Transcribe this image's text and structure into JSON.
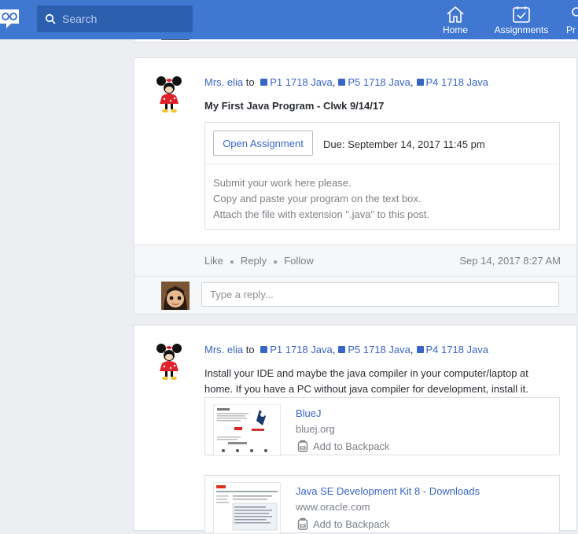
{
  "search": {
    "placeholder": "Search"
  },
  "nav": {
    "home": "Home",
    "assignments": "Assignments",
    "profile_partial": "Pr"
  },
  "post1": {
    "author": "Mrs. elia",
    "to": "to",
    "groups": [
      "P1 1718 Java",
      "P5 1718 Java",
      "P4 1718 Java"
    ],
    "title": "My First Java Program - Clwk 9/14/17",
    "open_label": "Open Assignment",
    "due": "Due: September 14, 2017 11:45 pm",
    "description": [
      "Submit your work here please.",
      "Copy and paste your program on the text box.",
      "Attach the file with extension \".java\" to this post."
    ],
    "actions": {
      "like": "Like",
      "reply": "Reply",
      "follow": "Follow"
    },
    "timestamp": "Sep 14, 2017 8:27 AM",
    "reply_placeholder": "Type a reply..."
  },
  "post2": {
    "author": "Mrs. elia",
    "to": "to",
    "groups": [
      "P1 1718 Java",
      "P5 1718 Java",
      "P4 1718 Java"
    ],
    "body": [
      "Install your IDE and maybe the java compiler in your computer/laptop at",
      "home. If you have a PC without java compiler for development, install it."
    ],
    "links": [
      {
        "title": "BlueJ",
        "domain": "bluej.org",
        "backpack": "Add to Backpack"
      },
      {
        "title": "Java SE Development Kit 8 - Downloads",
        "domain": "www.oracle.com",
        "backpack": "Add to Backpack"
      }
    ]
  },
  "colors": {
    "topbar": "#3f77d1",
    "link": "#3866c4",
    "background": "#eceef1"
  }
}
